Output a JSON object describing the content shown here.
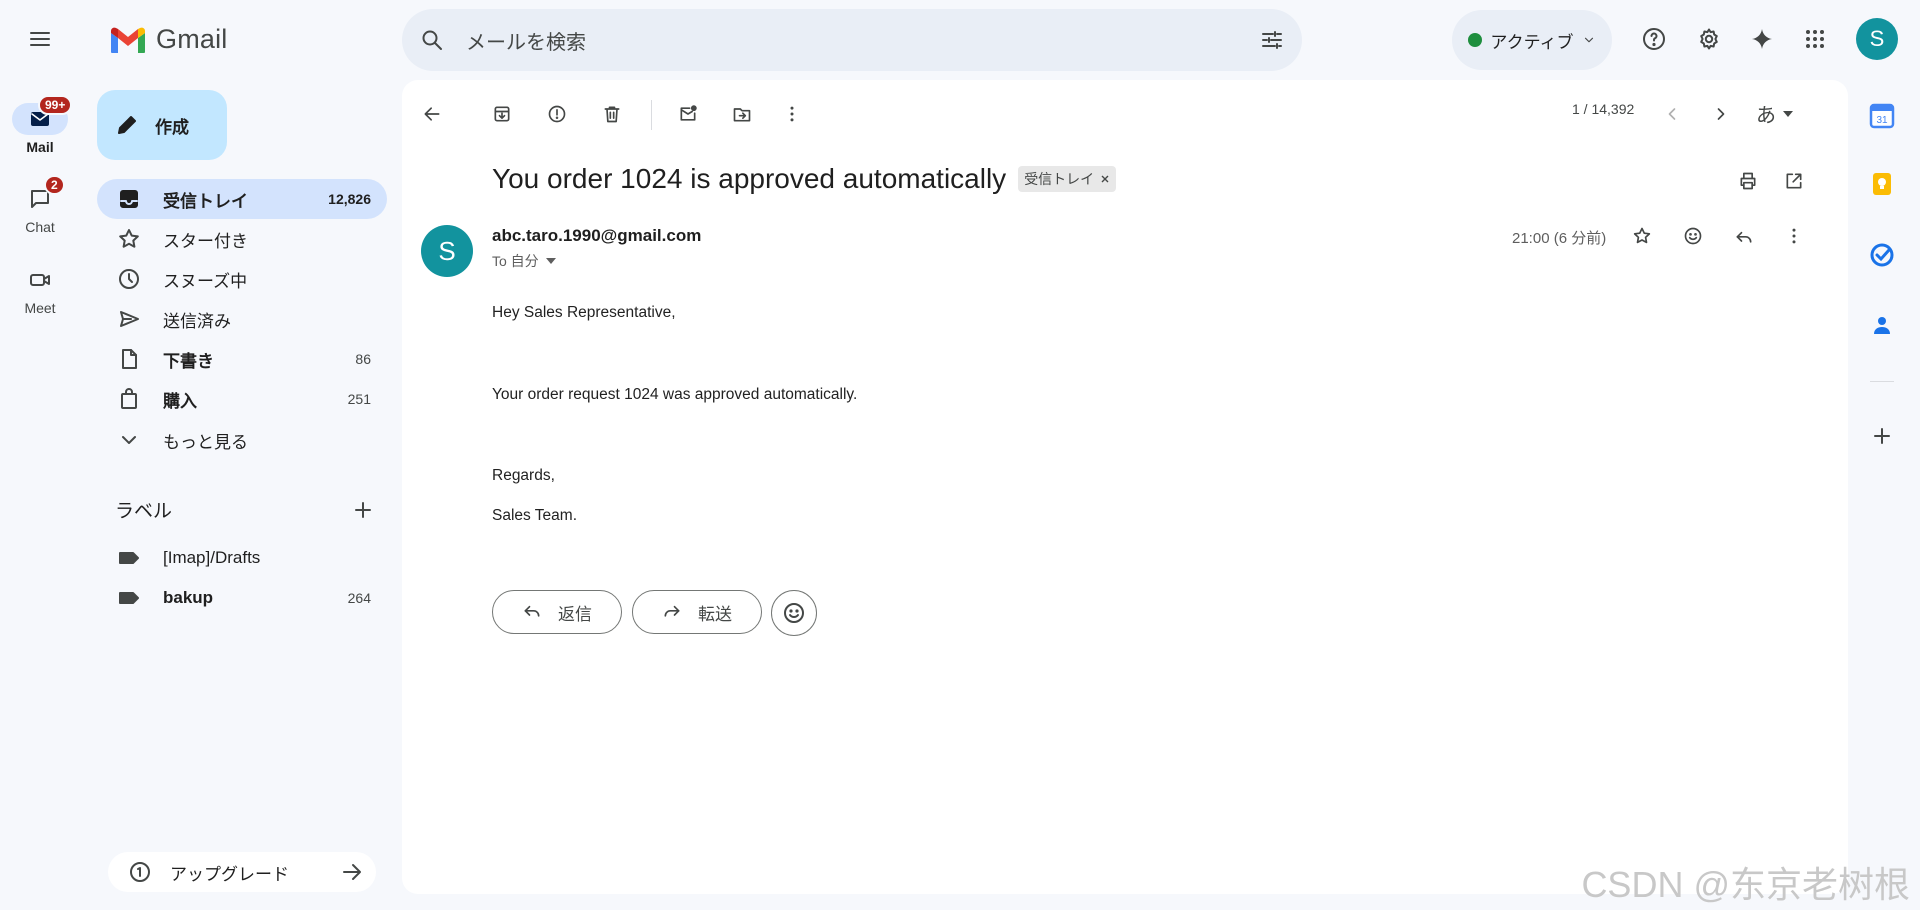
{
  "app": {
    "logo_text": "Gmail"
  },
  "search": {
    "placeholder": "メールを検索"
  },
  "status": {
    "label": "アクティブ"
  },
  "user": {
    "avatar_letter": "S"
  },
  "rail": {
    "mail": {
      "label": "Mail",
      "badge": "99+"
    },
    "chat": {
      "label": "Chat",
      "badge": "2"
    },
    "meet": {
      "label": "Meet"
    }
  },
  "compose": {
    "label": "作成"
  },
  "nav": [
    {
      "label": "受信トレイ",
      "count": "12,826",
      "icon": "inbox-icon"
    },
    {
      "label": "スター付き",
      "count": "",
      "icon": "star-icon"
    },
    {
      "label": "スヌーズ中",
      "count": "",
      "icon": "clock-icon"
    },
    {
      "label": "送信済み",
      "count": "",
      "icon": "send-icon"
    },
    {
      "label": "下書き",
      "count": "86",
      "icon": "draft-icon"
    },
    {
      "label": "購入",
      "count": "251",
      "icon": "shopping-bag-icon"
    },
    {
      "label": "もっと見る",
      "count": "",
      "icon": "chevron-down-icon"
    }
  ],
  "labels": {
    "heading": "ラベル",
    "items": [
      {
        "label": "[Imap]/Drafts",
        "count": ""
      },
      {
        "label": "bakup",
        "count": "264"
      }
    ]
  },
  "upgrade": {
    "label": "アップグレード"
  },
  "toolbar": {
    "pager": "1 / 14,392",
    "input_tool": "あ"
  },
  "message": {
    "subject": "You order 1024 is approved automatically",
    "label_chip": "受信トレイ",
    "sender": "abc.taro.1990@gmail.com",
    "to": "To 自分",
    "time": "21:00 (6 分前)",
    "body": [
      "Hey Sales Representative,",
      "Your order request 1024 was approved automatically.",
      "Regards,",
      "Sales Team."
    ]
  },
  "actions": {
    "reply": "返信",
    "forward": "転送"
  },
  "watermark": "CSDN @东京老树根",
  "colors": {
    "accent": "#0b57d0",
    "compose_bg": "#c2e7ff",
    "active_nav": "#d3e3fd",
    "avatar": "#12939e",
    "status_green": "#1e8e3e"
  }
}
